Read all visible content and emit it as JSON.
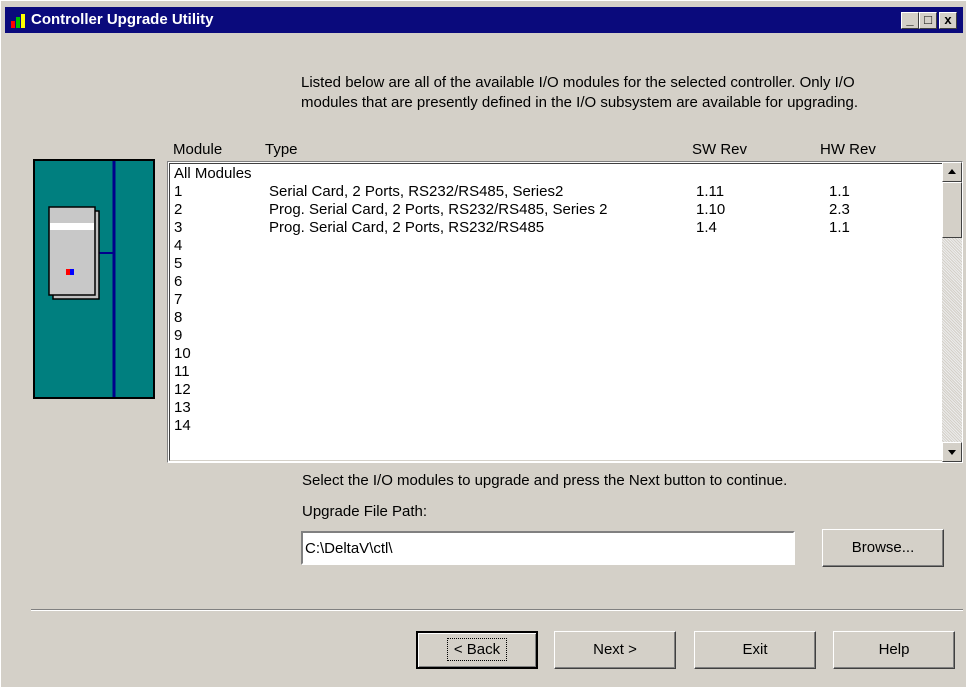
{
  "window": {
    "title": "Controller Upgrade Utility",
    "controls": {
      "minimize": "_",
      "maximize": "□",
      "close": "x"
    }
  },
  "intro": {
    "line1": "Listed below are all of the available I/O modules for the selected controller. Only I/O",
    "line2": "modules that are presently defined in the I/O subsystem are available for upgrading."
  },
  "list": {
    "columns": {
      "module": "Module",
      "type": "Type",
      "sw_rev": "SW Rev",
      "hw_rev": "HW Rev"
    },
    "rows": [
      {
        "module": "All Modules",
        "type": "",
        "sw": "",
        "hw": ""
      },
      {
        "module": "1",
        "type": "Serial Card, 2 Ports, RS232/RS485, Series2",
        "sw": "1.11",
        "hw": "1.1"
      },
      {
        "module": "2",
        "type": "Prog. Serial Card, 2 Ports, RS232/RS485, Series 2",
        "sw": "1.10",
        "hw": "2.3"
      },
      {
        "module": "3",
        "type": "Prog. Serial Card, 2 Ports, RS232/RS485",
        "sw": "1.4",
        "hw": "1.1"
      },
      {
        "module": "4",
        "type": "",
        "sw": "",
        "hw": ""
      },
      {
        "module": "5",
        "type": "",
        "sw": "",
        "hw": ""
      },
      {
        "module": "6",
        "type": "",
        "sw": "",
        "hw": ""
      },
      {
        "module": "7",
        "type": "",
        "sw": "",
        "hw": ""
      },
      {
        "module": "8",
        "type": "",
        "sw": "",
        "hw": ""
      },
      {
        "module": "9",
        "type": "",
        "sw": "",
        "hw": ""
      },
      {
        "module": "10",
        "type": "",
        "sw": "",
        "hw": ""
      },
      {
        "module": "11",
        "type": "",
        "sw": "",
        "hw": ""
      },
      {
        "module": "12",
        "type": "",
        "sw": "",
        "hw": ""
      },
      {
        "module": "13",
        "type": "",
        "sw": "",
        "hw": ""
      },
      {
        "module": "14",
        "type": "",
        "sw": "",
        "hw": ""
      }
    ]
  },
  "hint": "Select the I/O modules to upgrade and press the Next button to continue.",
  "path": {
    "label": "Upgrade File Path:",
    "value": "C:\\DeltaV\\ctl\\"
  },
  "buttons": {
    "browse": "Browse...",
    "back": "< Back",
    "next": "Next >",
    "exit": "Exit",
    "help": "Help"
  },
  "icons": {
    "app": "controller-app-icon",
    "graphic": "controller-module-graphic"
  },
  "colors": {
    "titlebar": "#0a0a7c",
    "face": "#d4d0c8",
    "graphic_bg": "#007f7f"
  }
}
